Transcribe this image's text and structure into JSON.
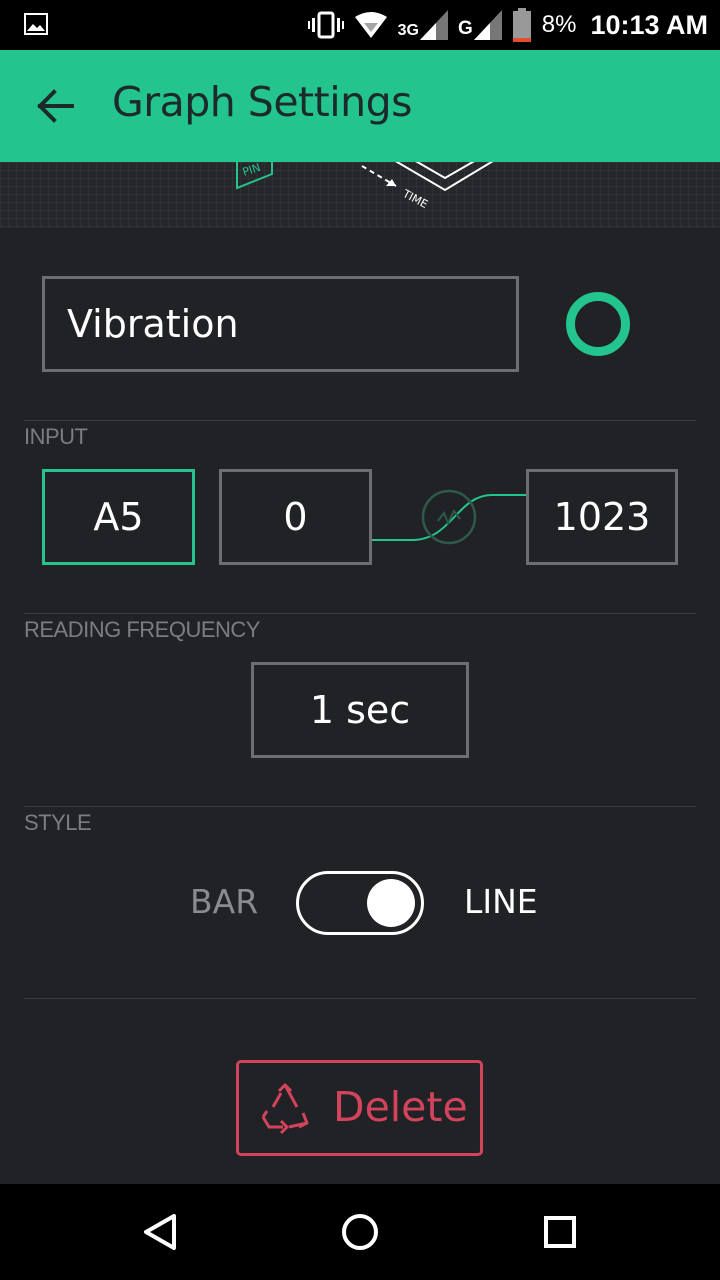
{
  "status_bar": {
    "network_3g": "3G",
    "network_g": "G",
    "battery_percent": "8%",
    "time": "10:13 AM",
    "icons": [
      "image-icon",
      "vibrate-icon",
      "wifi-icon",
      "signal-icon",
      "battery-icon"
    ]
  },
  "app_bar": {
    "title": "Graph Settings",
    "back_icon": "arrow-left-icon"
  },
  "illustration": {
    "label_pin": "PIN",
    "label_time": "TIME"
  },
  "name_field": {
    "value": "Vibration"
  },
  "color_picker": {
    "color": "#23c48e"
  },
  "input": {
    "label": "INPUT",
    "pin": "A5",
    "min": "0",
    "max": "1023"
  },
  "reading_frequency": {
    "label": "READING FREQUENCY",
    "value": "1 sec"
  },
  "style": {
    "label": "STYLE",
    "option_bar": "BAR",
    "option_line": "LINE",
    "selected": "LINE"
  },
  "delete_button": {
    "label": "Delete",
    "icon": "recycle-icon"
  },
  "nav_bar": {
    "icons": [
      "back-triangle-icon",
      "home-circle-icon",
      "recents-square-icon"
    ]
  },
  "colors": {
    "accent": "#23c48e",
    "background": "#212226",
    "danger": "#d3435c",
    "border": "#6d6e72"
  }
}
